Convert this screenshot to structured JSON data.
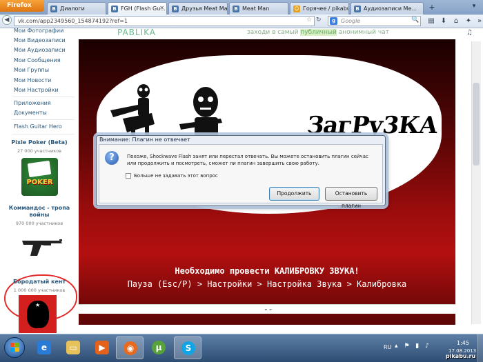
{
  "browser": {
    "menu_button": "Firefox",
    "tabs": [
      {
        "label": "Диалоги",
        "icon": "vk-icon"
      },
      {
        "label": "FGH (Flash Gu...",
        "icon": "vk-icon",
        "active": true
      },
      {
        "label": "Друзья Meat Ma...",
        "icon": "vk-icon"
      },
      {
        "label": "Meat Man",
        "icon": "vk-icon"
      },
      {
        "label": "Горячее / pikabu...",
        "icon": "pikabu-icon"
      },
      {
        "label": "Аудиозаписи Me...",
        "icon": "vk-icon"
      }
    ],
    "new_tab": "+",
    "url": "vk.com/app2349560_154874192?ref=1",
    "search_placeholder": "Google",
    "search_engine_letter": "g"
  },
  "sidebar": {
    "menu_items": [
      "Мои Фотографии",
      "Мои Видеозаписи",
      "Мои Аудиозаписи",
      "Мои Сообщения",
      "Мои Группы",
      "Мои Новости",
      "Мои Настройки"
    ],
    "extra_items": [
      "Приложения",
      "Документы"
    ],
    "app_item": "Flash Guitar Hero",
    "ads": [
      {
        "title": "Pixie Poker (Beta)",
        "subtitle": "27 000 участников",
        "image_text": "POKER"
      },
      {
        "title": "Коммандос - тропа войны",
        "subtitle": "970 000 участников"
      },
      {
        "title": "Бородатый кент",
        "subtitle": "1 000 000 участников"
      }
    ]
  },
  "app_banner": {
    "logo": "PABLIKA",
    "text_before": "заходи в самый ",
    "text_highlight": "публичный",
    "text_after": " анонимный чат"
  },
  "flash": {
    "loading_title": "ЗагРу3КА",
    "calibration_line1": "Необходимо провести КАЛИБРОВКУ ЗВУКА!",
    "calibration_line2": "Пауза (Esc/P) > Настройки > Настройка Звука > Калибровка"
  },
  "dialog": {
    "title": "Внимание: Плагин не отвечает",
    "message": "Похоже, Shockwave Flash занят или перестал отвечать. Вы можете остановить плагин сейчас или продолжить и посмотреть, сможет ли плагин завершить свою работу.",
    "checkbox_label": "Больше не задавать этот вопрос",
    "checkbox_checked": false,
    "continue_button": "Продолжить",
    "stop_button": "Остановить плагин"
  },
  "taskbar": {
    "apps": [
      "ie-icon",
      "explorer-icon",
      "media-player-icon",
      "firefox-icon",
      "utorrent-icon",
      "skype-icon"
    ],
    "language": "RU",
    "time": "1:45",
    "date": "17.08.2013"
  },
  "watermark": "pikabu.ru",
  "colors": {
    "vk_link": "#2b587a",
    "dialog_bg": "#e9eef5",
    "taskbar": "#2e4d73",
    "highlight_circle": "#e32a2a"
  }
}
